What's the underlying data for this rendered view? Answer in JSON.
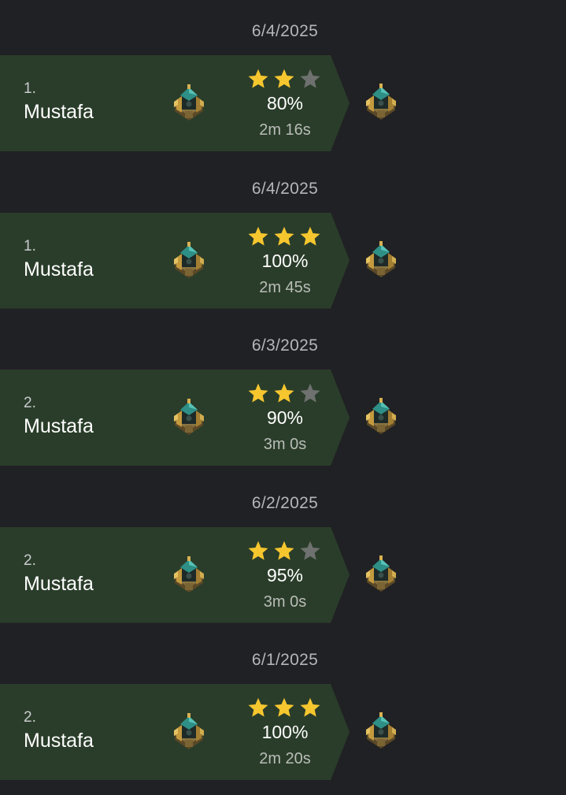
{
  "entries": [
    {
      "date": "6/4/2025",
      "rank": "1.",
      "name": "Mustafa",
      "stars": 2,
      "max_stars": 3,
      "percent": "80%",
      "duration": "2m 16s"
    },
    {
      "date": "6/4/2025",
      "rank": "1.",
      "name": "Mustafa",
      "stars": 3,
      "max_stars": 3,
      "percent": "100%",
      "duration": "2m 45s"
    },
    {
      "date": "6/3/2025",
      "rank": "2.",
      "name": "Mustafa",
      "stars": 2,
      "max_stars": 3,
      "percent": "90%",
      "duration": "3m 0s"
    },
    {
      "date": "6/2/2025",
      "rank": "2.",
      "name": "Mustafa",
      "stars": 2,
      "max_stars": 3,
      "percent": "95%",
      "duration": "3m 0s"
    },
    {
      "date": "6/1/2025",
      "rank": "2.",
      "name": "Mustafa",
      "stars": 3,
      "max_stars": 3,
      "percent": "100%",
      "duration": "2m 20s"
    }
  ],
  "colors": {
    "background": "#202124",
    "banner": "#2a3d2a",
    "star_filled": "#f6c62f",
    "star_empty": "#6e716f",
    "date_text": "#b4b6ba",
    "duration_text": "#b9bdb8"
  },
  "icons": {
    "inner": "town-hall-icon",
    "outer": "town-hall-icon",
    "star": "star-icon"
  }
}
